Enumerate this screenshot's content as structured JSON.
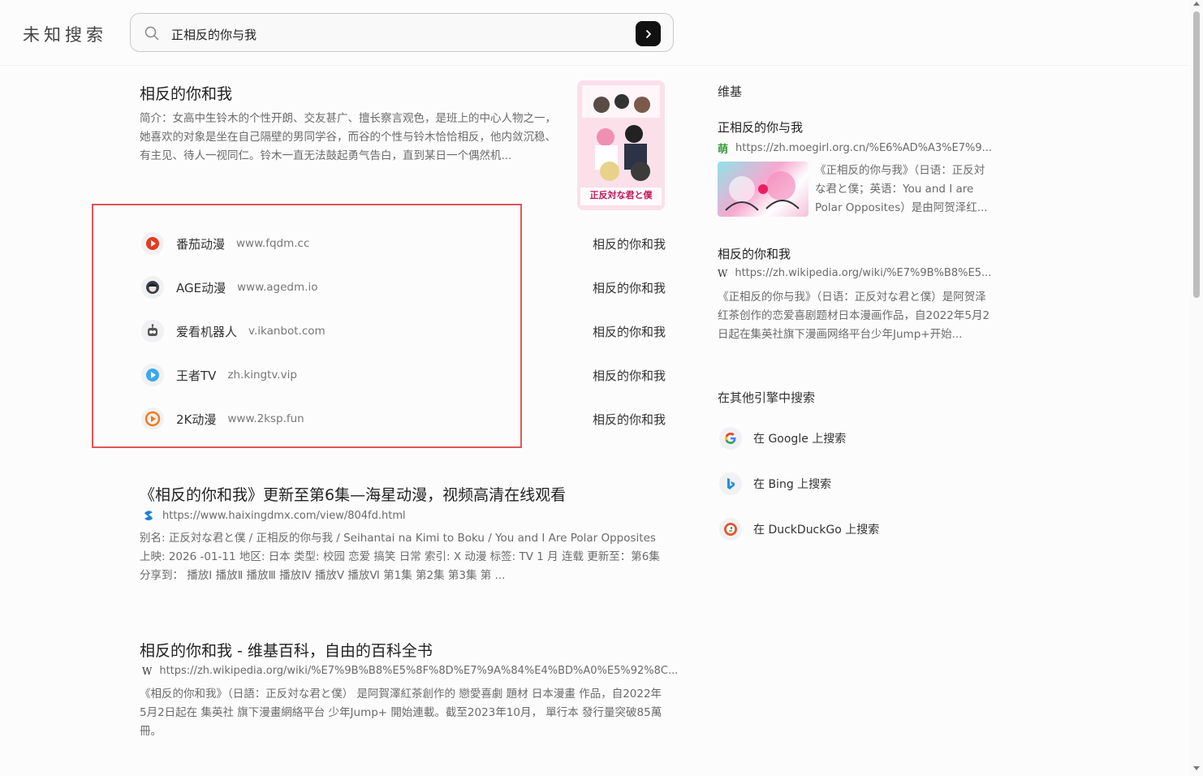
{
  "app": {
    "brand": "未知搜索"
  },
  "search": {
    "query": "正相反的你与我"
  },
  "anime_card": {
    "title": "相反的你和我",
    "summary": "简介：女高中生铃木的个性开朗、交友甚广、擅长察言观色，是班上的中心人物之一，她喜欢的对象是坐在自己隔壁的男同学谷，而谷的个性与铃木恰恰相反，他内敛沉稳、有主见、待人一视同仁。铃木一直无法鼓起勇气告白，直到某日一个偶然机...",
    "poster_text": "正反対な君と僕"
  },
  "streaming_sites": [
    {
      "name": "番茄动漫",
      "domain": "www.fqdm.cc",
      "link": "相反的你和我",
      "icon": "tomato-icon",
      "color": "#e63b1f"
    },
    {
      "name": "AGE动漫",
      "domain": "www.agedm.io",
      "link": "相反的你和我",
      "icon": "age-avatar-icon",
      "color": "#3a3f52"
    },
    {
      "name": "爱看机器人",
      "domain": "v.ikanbot.com",
      "link": "相反的你和我",
      "icon": "robot-icon",
      "color": "#555555"
    },
    {
      "name": "王者TV",
      "domain": "zh.kingtv.vip",
      "link": "相反的你和我",
      "icon": "play-icon",
      "color": "#3aa8f0"
    },
    {
      "name": "2K动漫",
      "domain": "www.2ksp.fun",
      "link": "相反的你和我",
      "icon": "2k-icon",
      "color": "#f07b1c"
    }
  ],
  "results": [
    {
      "title": "《相反的你和我》更新至第6集—海星动漫，视频高清在线观看",
      "url": "https://www.haixingdmx.com/view/804fd.html",
      "snippet": "别名: 正反対な君と僕 / 正相反的你与我 / Seihantai na Kimi to Boku / You and I Are Polar Opposites 上映: 2026 -01-11 地区: 日本 类型: 校园 恋爱 搞笑 日常 索引: X 动漫 标签: TV 1 月 连载 更新至：第6集 分享到： 播放Ⅰ 播放Ⅱ 播放Ⅲ 播放Ⅳ 播放Ⅴ 播放Ⅵ 第1集 第2集 第3集 第 ..."
    },
    {
      "title": "相反的你和我 - 维基百科，自由的百科全书",
      "url": "https://zh.wikipedia.org/wiki/%E7%9B%B8%E5%8F%8D%E7%9A%84%E4%BD%A0%E5%92%8C...",
      "snippet": "《相反的你和我》（日語：正反対な君と僕） 是阿賀澤紅茶創作的 戀愛喜劇 題材 日本漫畫 作品，自2022年5月2日起在 集英社 旗下漫畫網絡平台 少年Jump+ 開始連載。截至2023年10月， 單行本 發行量突破85萬冊。"
    }
  ],
  "right_panel": {
    "heading": "维基",
    "entries": [
      {
        "title": "正相反的你与我",
        "url": "https://zh.moegirl.org.cn/%E6%AD%A3%E7%9...",
        "favicon": "萌",
        "text": "《正相反的你与我》（日语：正反対な君と僕；英语：You and I are Polar Opposites）是由阿贺泽红..."
      },
      {
        "title": "相反的你和我",
        "url": "https://zh.wikipedia.org/wiki/%E7%9B%B8%E5...",
        "favicon": "W",
        "text": "《正相反的你与我》（日语：正反対な君と僕）是阿贺泽红茶创作的恋爱喜剧题材日本漫画作品，自2022年5月2日起在集英社旗下漫画网络平台少年Jump+开始..."
      }
    ],
    "other_engines_heading": "在其他引擎中搜索",
    "engines": [
      {
        "label": "在 Google 上搜索",
        "icon": "google-icon"
      },
      {
        "label": "在 Bing 上搜索",
        "icon": "bing-icon"
      },
      {
        "label": "在 DuckDuckGo 上搜索",
        "icon": "duckduckgo-icon"
      }
    ]
  }
}
